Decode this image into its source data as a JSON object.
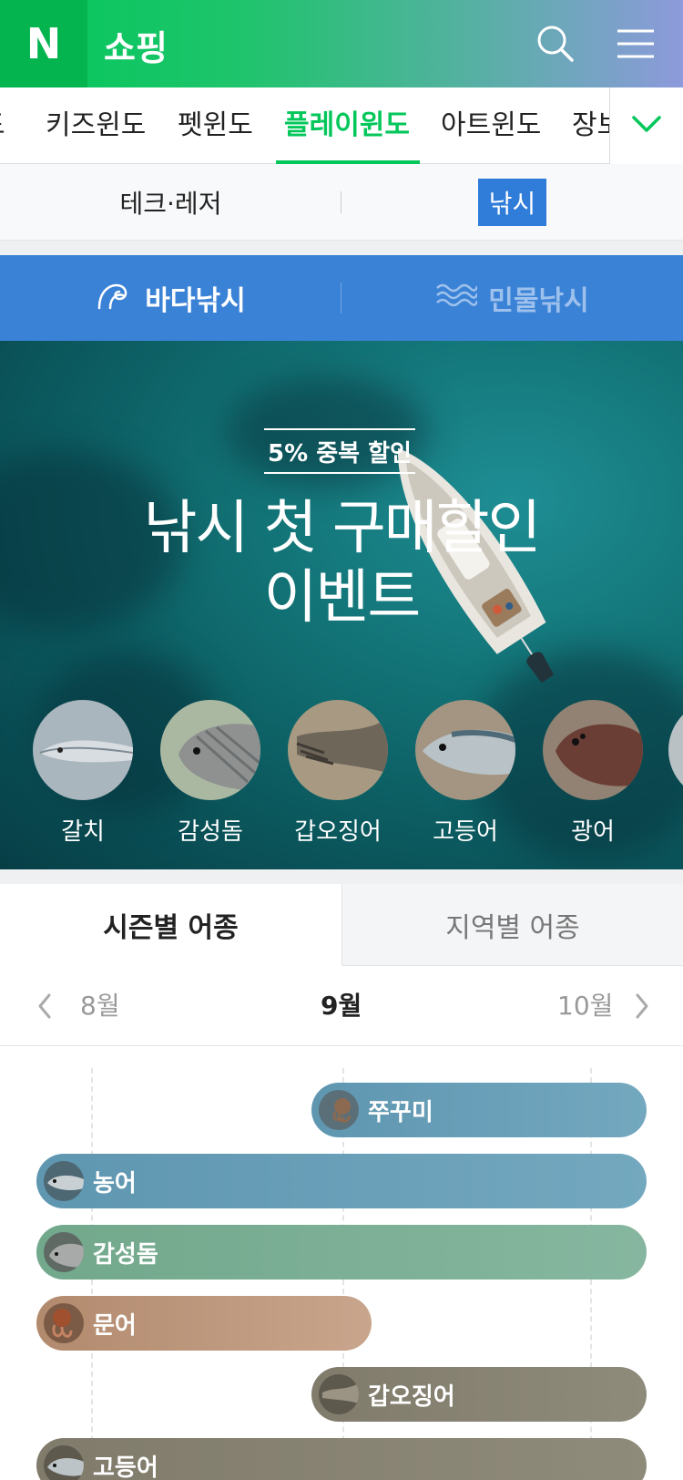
{
  "header": {
    "logo": "N",
    "title": "쇼핑",
    "search_icon": "search-icon",
    "menu_icon": "hamburger-menu-icon",
    "colors": {
      "brand_green": "#03c75a",
      "gradient_end": "#8d9adb"
    }
  },
  "category_tabs": {
    "items": [
      {
        "label": "드"
      },
      {
        "label": "키즈윈도"
      },
      {
        "label": "펫윈도"
      },
      {
        "label": "플레이윈도",
        "active": true
      },
      {
        "label": "아트윈도"
      },
      {
        "label": "장보"
      }
    ],
    "more_icon": "chevron-down-icon"
  },
  "sub_tabs": {
    "items": [
      {
        "label": "테크·레저"
      },
      {
        "label": "낚시",
        "active": true
      }
    ]
  },
  "fishing_type": {
    "items": [
      {
        "label": "바다낚시",
        "icon": "wave-icon",
        "active": true
      },
      {
        "label": "민물낚시",
        "icon": "ripple-icon",
        "active": false
      }
    ]
  },
  "hero": {
    "badge": "5% 중복 할인",
    "title_line1": "낚시 첫 구매할인",
    "title_line2": "이벤트",
    "fish": [
      {
        "label": "갈치"
      },
      {
        "label": "감성돔"
      },
      {
        "label": "갑오징어"
      },
      {
        "label": "고등어"
      },
      {
        "label": "광어"
      }
    ]
  },
  "species_tabs": {
    "items": [
      {
        "label": "시즌별 어종",
        "active": true
      },
      {
        "label": "지역별 어종",
        "active": false
      }
    ]
  },
  "month_nav": {
    "prev": "8월",
    "current": "9월",
    "next": "10월"
  },
  "season_bars": [
    {
      "label": "쭈꾸미",
      "color": "#6ea2ba"
    },
    {
      "label": "농어",
      "color": "#6ea2ba"
    },
    {
      "label": "감성돔",
      "color": "#7db39a"
    },
    {
      "label": "문어",
      "color": "#c29e84"
    },
    {
      "label": "갑오징어",
      "color": "#898574"
    },
    {
      "label": "고등어",
      "color": "#898574"
    }
  ]
}
